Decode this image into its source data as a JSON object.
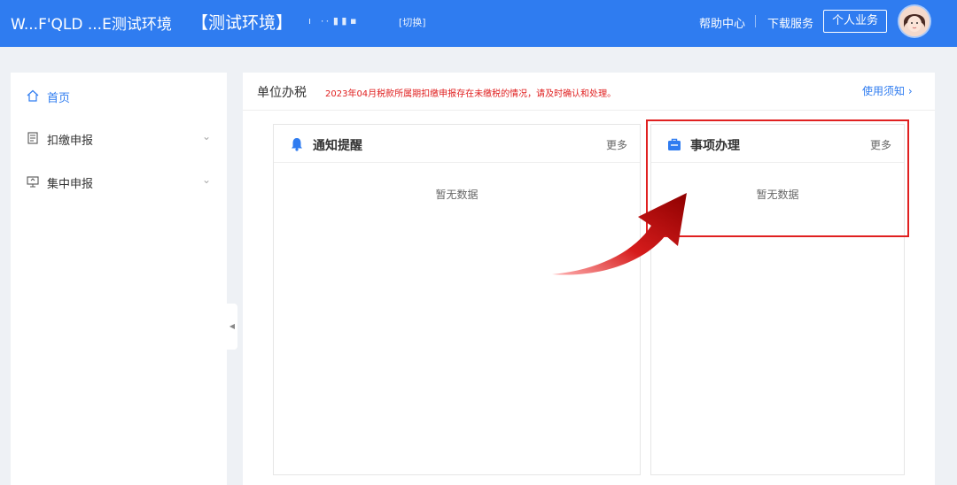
{
  "header": {
    "brand": "W...F'QLD ...E测试环境",
    "env_tag": "【测试环境】",
    "org_masked": "ı ٠٠ ▮ ▮ ▪",
    "switch_label": "[切换]",
    "help": "帮助中心",
    "download": "下载服务",
    "personal": "个人业务"
  },
  "sidebar": {
    "items": [
      {
        "label": "首页",
        "icon": "home-icon",
        "active": true
      },
      {
        "label": "扣缴申报",
        "icon": "form-icon"
      },
      {
        "label": "集中申报",
        "icon": "monitor-icon"
      }
    ]
  },
  "main": {
    "title": "单位办税",
    "notice": "2023年04月税款所属期扣缴申报存在未缴税的情况，请及时确认和处理。",
    "usage_link": "使用须知",
    "panels": [
      {
        "title": "通知提醒",
        "more": "更多",
        "empty": "暂无数据",
        "icon": "bell-icon"
      },
      {
        "title": "事项办理",
        "more": "更多",
        "empty": "暂无数据",
        "icon": "briefcase-icon"
      }
    ]
  },
  "colors": {
    "header_bg": "#2f7cf0",
    "accent": "#2f7cf0",
    "notice_red": "#e02020",
    "annotation_red": "#e02020"
  }
}
